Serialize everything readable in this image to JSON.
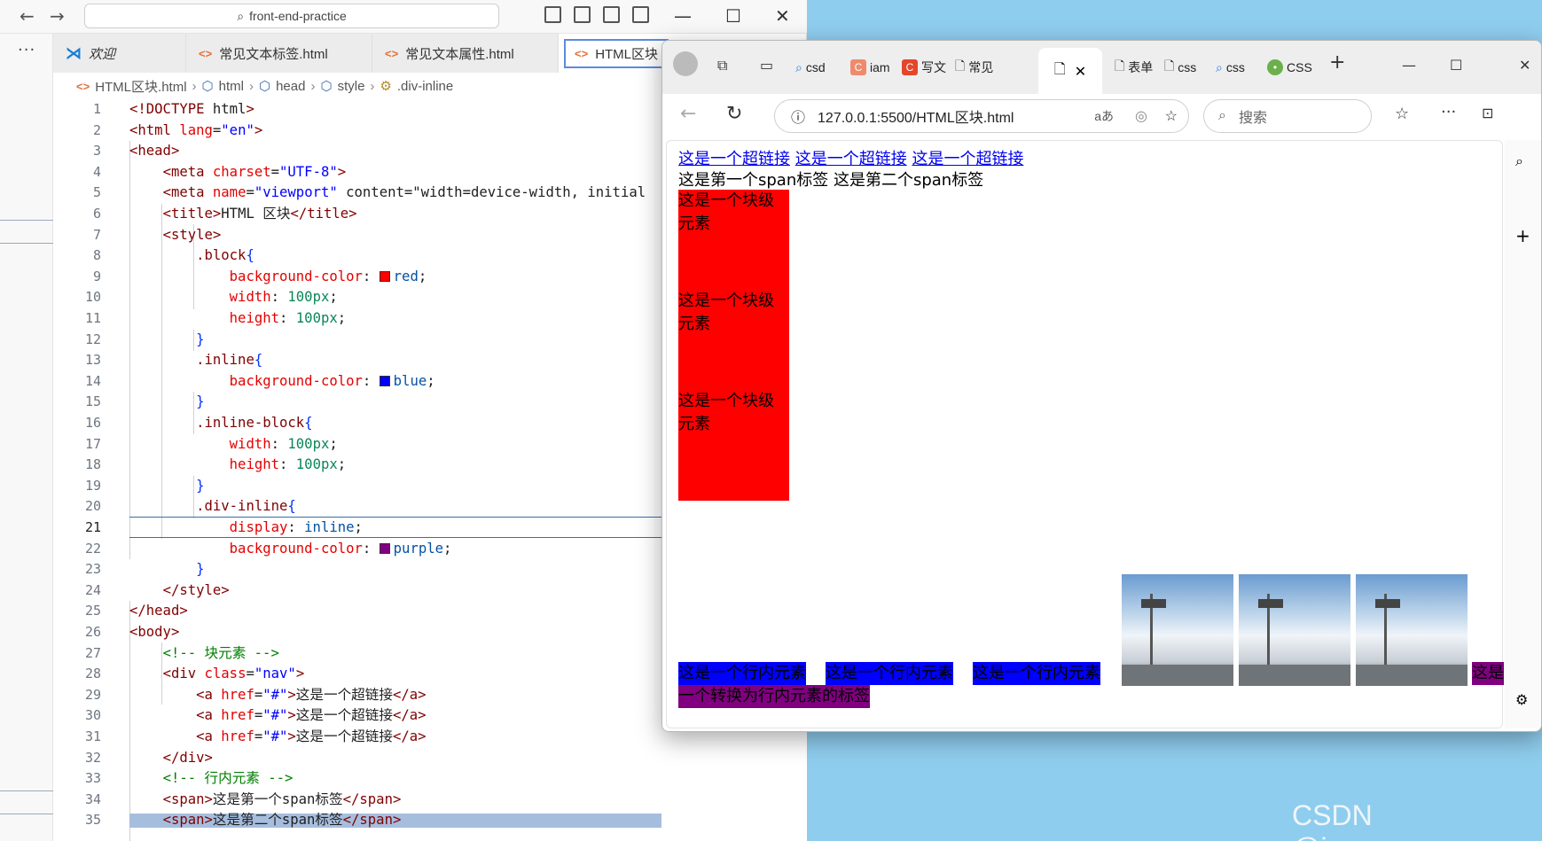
{
  "vscode": {
    "search_text": "front-end-practice",
    "tabs": [
      {
        "label": "欢迎",
        "icon": "vscode-logo-icon",
        "active": false
      },
      {
        "label": "常见文本标签.html",
        "icon": "html-file-icon",
        "active": false
      },
      {
        "label": "常见文本属性.html",
        "icon": "html-file-icon",
        "active": false
      },
      {
        "label": "HTML区块",
        "icon": "html-file-icon",
        "active": true
      }
    ],
    "breadcrumb": [
      "HTML区块.html",
      "html",
      "head",
      "style",
      ".div-inline"
    ],
    "current_line": 21,
    "lines": [
      {
        "n": "1",
        "code": "<!DOCTYPE html>"
      },
      {
        "n": "2",
        "code": "<html lang=\"en\">"
      },
      {
        "n": "3",
        "code": "<head>"
      },
      {
        "n": "4",
        "code": "    <meta charset=\"UTF-8\">"
      },
      {
        "n": "5",
        "code": "    <meta name=\"viewport\" content=\"width=device-width, initial"
      },
      {
        "n": "6",
        "code": "    <title>HTML 区块</title>"
      },
      {
        "n": "7",
        "code": "    <style>"
      },
      {
        "n": "8",
        "code": "        .block{"
      },
      {
        "n": "9",
        "code": "            background-color: red;"
      },
      {
        "n": "10",
        "code": "            width: 100px;"
      },
      {
        "n": "11",
        "code": "            height: 100px;"
      },
      {
        "n": "12",
        "code": "        }"
      },
      {
        "n": "13",
        "code": "        .inline{"
      },
      {
        "n": "14",
        "code": "            background-color: blue;"
      },
      {
        "n": "15",
        "code": "        }"
      },
      {
        "n": "16",
        "code": "        .inline-block{"
      },
      {
        "n": "17",
        "code": "            width: 100px;"
      },
      {
        "n": "18",
        "code": "            height: 100px;"
      },
      {
        "n": "19",
        "code": "        }"
      },
      {
        "n": "20",
        "code": "        .div-inline{"
      },
      {
        "n": "21",
        "code": "            display: inline;"
      },
      {
        "n": "22",
        "code": "            background-color: purple;"
      },
      {
        "n": "23",
        "code": "        }"
      },
      {
        "n": "24",
        "code": "    </style>"
      },
      {
        "n": "25",
        "code": "</head>"
      },
      {
        "n": "26",
        "code": "<body>"
      },
      {
        "n": "27",
        "code": "    <!-- 块元素 -->"
      },
      {
        "n": "28",
        "code": "    <div class=\"nav\">"
      },
      {
        "n": "29",
        "code": "        <a href=\"#\">这是一个超链接</a>"
      },
      {
        "n": "30",
        "code": "        <a href=\"#\">这是一个超链接</a>"
      },
      {
        "n": "31",
        "code": "        <a href=\"#\">这是一个超链接</a>"
      },
      {
        "n": "32",
        "code": "    </div>"
      },
      {
        "n": "33",
        "code": "    <!-- 行内元素 -->"
      },
      {
        "n": "34",
        "code": "    <span>这是第一个span标签</span>"
      },
      {
        "n": "35",
        "code": "    <span>这是第二个span标签</span>"
      }
    ],
    "swatch_colors": {
      "red": "#ff0000",
      "blue": "#0000ff",
      "purple": "#800080"
    }
  },
  "browser": {
    "tabs": [
      "csd",
      "iam",
      "写文",
      "常见",
      "表单",
      "css",
      "css",
      "CSS"
    ],
    "address": "127.0.0.1:5500/HTML区块.html",
    "search_placeholder": "搜索",
    "page": {
      "links": [
        "这是一个超链接",
        "这是一个超链接",
        "这是一个超链接"
      ],
      "spans": "这是第一个span标签 这是第二个span标签",
      "blocks": [
        "这是一个块级元素",
        "这是一个块级元素",
        "这是一个块级元素"
      ],
      "inline_items": [
        "这是一个行内元素",
        "这是一个行内元素",
        "这是一个行内元素"
      ],
      "converted_part1": "这是",
      "converted_part2": "一个转换为行内元素的标签"
    }
  },
  "watermark": "CSDN @iamegeege"
}
